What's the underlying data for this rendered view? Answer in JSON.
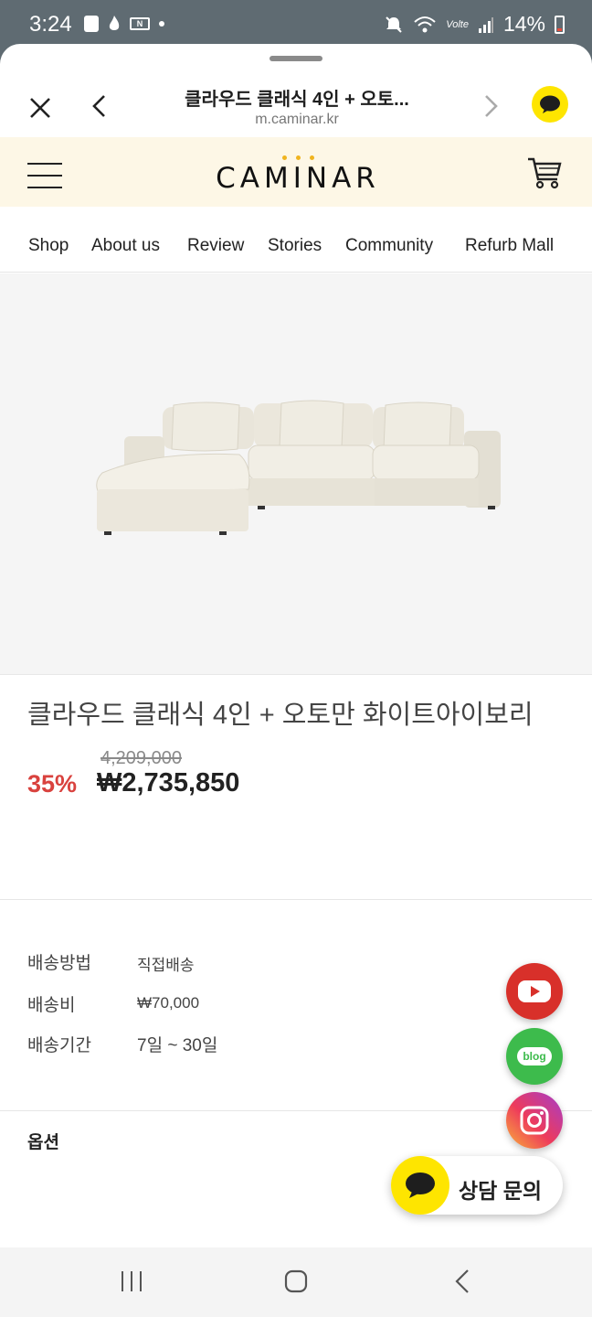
{
  "status_bar": {
    "time": "3:24",
    "battery": "14%",
    "network": "Volte"
  },
  "browser": {
    "title": "클라우드 클래식 4인 + 오토...",
    "url": "m.caminar.kr"
  },
  "site": {
    "logo": "CAMINAR",
    "nav": [
      "Shop",
      "About us",
      "Review",
      "Stories",
      "Community",
      "Refurb Mall"
    ]
  },
  "product": {
    "name": "클라우드 클래식 4인 + 오토만 화이트아이보리",
    "original_price": "4,209,000",
    "discount": "35%",
    "price": "₩2,735,850"
  },
  "shipping": {
    "rows": [
      {
        "label": "배송방법",
        "value": "직접배송"
      },
      {
        "label": "배송비",
        "value": "₩70,000"
      },
      {
        "label": "배송기간",
        "value": "7일 ~ 30일"
      }
    ]
  },
  "options": {
    "label": "옵션"
  },
  "floating": {
    "blog_label": "blog",
    "chat_label": "상담 문의"
  },
  "colors": {
    "header_bg": "#fdf7e6",
    "discount_red": "#d9423e",
    "kakao_yellow": "#fee500"
  }
}
